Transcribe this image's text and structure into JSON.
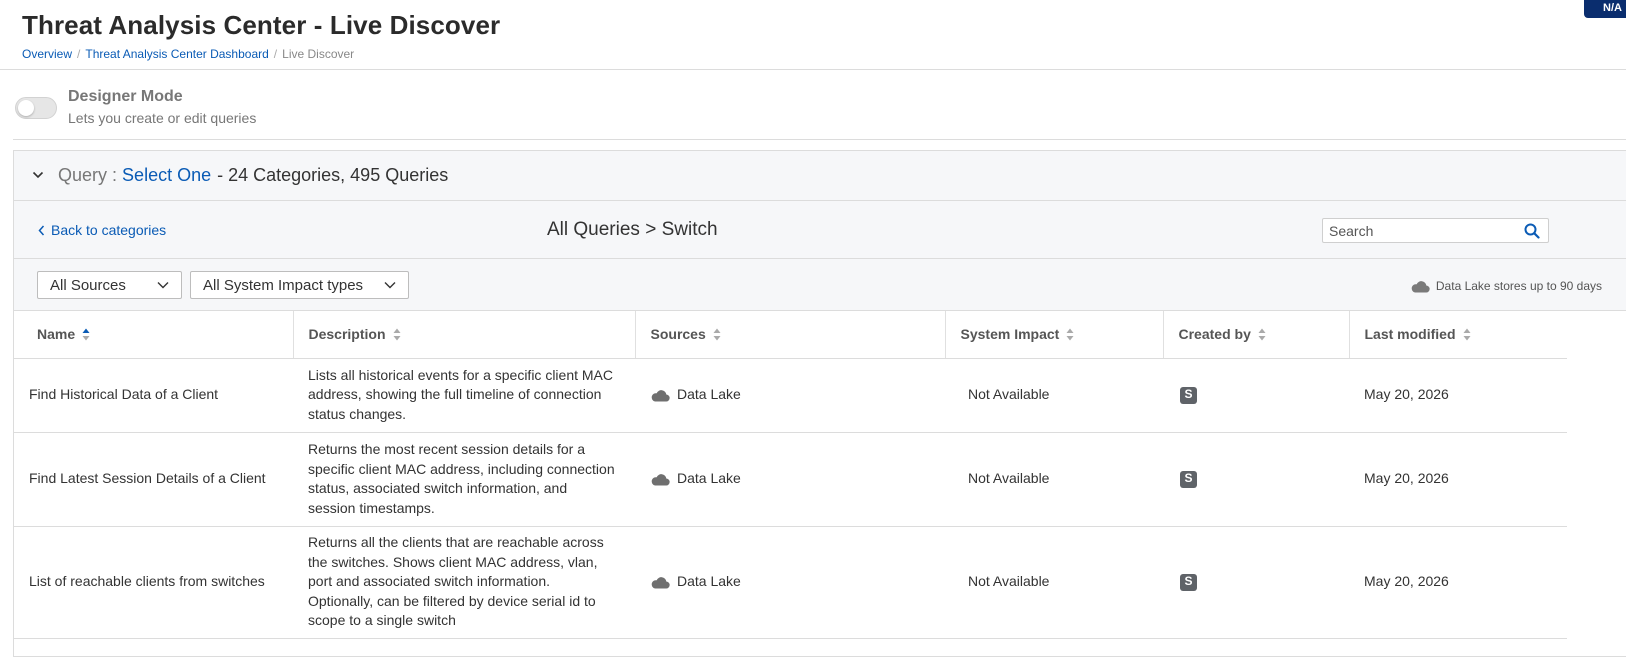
{
  "header": {
    "title": "Threat Analysis Center - Live Discover",
    "corner_badge": "N/A",
    "breadcrumb": [
      {
        "label": "Overview"
      },
      {
        "label": "Threat Analysis Center Dashboard"
      },
      {
        "label": "Live Discover"
      }
    ]
  },
  "designer": {
    "title": "Designer Mode",
    "subtitle": "Lets you create or edit queries",
    "enabled": false
  },
  "query_bar": {
    "label": "Query",
    "colon": ":",
    "selection": "Select One",
    "summary": "- 24 Categories, 495 Queries"
  },
  "nav": {
    "back_label": "Back to categories",
    "path": "All Queries > Switch",
    "search_placeholder": "Search"
  },
  "filters": {
    "sources_selected": "All Sources",
    "impact_selected": "All System Impact types",
    "data_lake_note": "Data Lake stores up to 90 days"
  },
  "table": {
    "columns": [
      "Name",
      "Description",
      "Sources",
      "System Impact",
      "Created by",
      "Last modified"
    ],
    "rows": [
      {
        "name": "Find Historical Data of a Client",
        "description": "Lists all historical events for a specific client MAC address, showing the full timeline of connection status changes.",
        "source": "Data Lake",
        "impact": "Not Available",
        "created_by": "S",
        "modified": "May 20, 2026"
      },
      {
        "name": "Find Latest Session Details of a Client",
        "description": "Returns the most recent session details for a specific client MAC address, including connection status, associated switch information, and session timestamps.",
        "source": "Data Lake",
        "impact": "Not Available",
        "created_by": "S",
        "modified": "May 20, 2026"
      },
      {
        "name": "List of reachable clients from switches",
        "description": "Returns all the clients that are reachable across the switches. Shows client MAC address, vlan, port and associated switch information. Optionally, can be filtered by device serial id to scope to a single switch",
        "source": "Data Lake",
        "impact": "Not Available",
        "created_by": "S",
        "modified": "May 20, 2026"
      }
    ]
  },
  "colors": {
    "link": "#0a5bb5",
    "badge_bg": "#0a2d6e",
    "panel_bg": "#f6f7f9"
  }
}
